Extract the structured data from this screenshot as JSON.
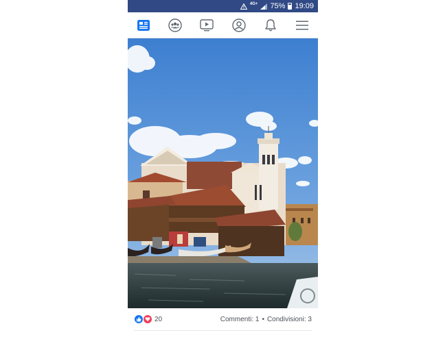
{
  "status_bar": {
    "network": "4G+",
    "battery": "75%",
    "time": "19:09",
    "colors": {
      "background": "#314a86"
    }
  },
  "nav": {
    "items": [
      {
        "icon": "news-feed-icon",
        "active": true
      },
      {
        "icon": "groups-icon",
        "active": false
      },
      {
        "icon": "watch-video-icon",
        "active": false
      },
      {
        "icon": "profile-icon",
        "active": false
      },
      {
        "icon": "notifications-bell-icon",
        "active": false
      },
      {
        "icon": "menu-hamburger-icon",
        "active": false
      }
    ],
    "accent": "#1877f2"
  },
  "post": {
    "reaction_count": "20",
    "comments": "Commenti: 1",
    "separator": "•",
    "shares": "Condivisioni: 3"
  }
}
